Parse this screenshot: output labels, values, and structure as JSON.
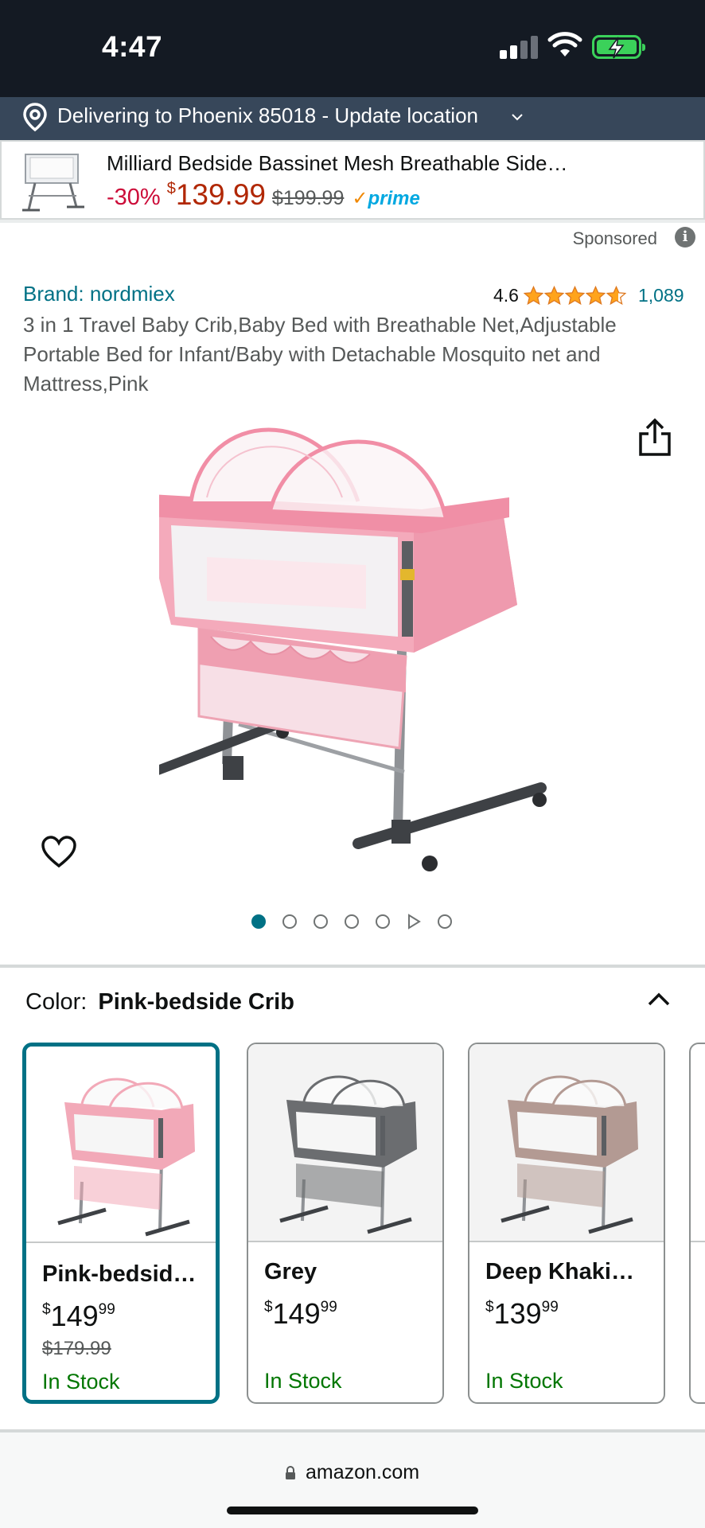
{
  "status_bar": {
    "time": "4:47"
  },
  "location": {
    "text": "Delivering to Phoenix 85018 - Update location"
  },
  "sponsored_ad": {
    "title": "Milliard Bedside Bassinet Mesh Breathable Side…",
    "discount": "-30%",
    "price_symbol": "$",
    "price": "139.99",
    "list_price": "$199.99",
    "prime_label": "prime"
  },
  "sponsored_label": "Sponsored",
  "product": {
    "brand": "Brand: nordmiex",
    "rating": "4.6",
    "rating_stars": 4.6,
    "rating_count": "1,089",
    "title": "3 in 1 Travel Baby Crib,Baby Bed with Breathable Net,Adjustable Portable Bed for Infant/Baby with Detachable Mosquito net and Mattress,Pink"
  },
  "color_selector": {
    "label": "Color:",
    "selected": "Pink-bedside Crib",
    "options": [
      {
        "name": "Pink-bedsid…",
        "symbol": "$",
        "dollars": "149",
        "cents": "99",
        "list_price": "$179.99",
        "stock": "In Stock",
        "fabric": "#f2a9b8"
      },
      {
        "name": "Grey",
        "symbol": "$",
        "dollars": "149",
        "cents": "99",
        "list_price": "",
        "stock": "In Stock",
        "fabric": "#6b6d70"
      },
      {
        "name": "Deep Khaki…",
        "symbol": "$",
        "dollars": "139",
        "cents": "99",
        "list_price": "",
        "stock": "In Stock",
        "fabric": "#b39a93"
      }
    ]
  },
  "browser": {
    "url": "amazon.com"
  },
  "colors": {
    "link": "#007185",
    "price_red": "#b12704",
    "discount_red": "#cc0c39",
    "in_stock": "#007600",
    "star": "#ffa41c",
    "location_bg": "#37475a"
  },
  "icons": [
    "location-pin-icon",
    "chevron-down-icon",
    "check-icon",
    "info-icon",
    "star-icon",
    "share-icon",
    "heart-icon",
    "play-icon",
    "chevron-up-icon",
    "lock-icon"
  ]
}
